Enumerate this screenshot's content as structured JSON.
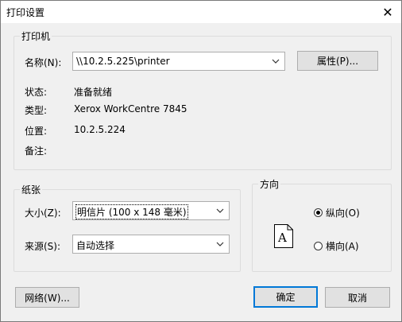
{
  "window": {
    "title": "打印设置",
    "close_glyph": "✕"
  },
  "printer": {
    "group_label": "打印机",
    "name_label": "名称(N):",
    "name_value": "\\\\10.2.5.225\\printer",
    "properties_button": "属性(P)...",
    "status_label": "状态:",
    "status_value": "准备就绪",
    "type_label": "类型:",
    "type_value": "Xerox WorkCentre 7845",
    "location_label": "位置:",
    "location_value": "10.2.5.224",
    "comment_label": "备注:",
    "comment_value": ""
  },
  "paper": {
    "group_label": "纸张",
    "size_label": "大小(Z):",
    "size_value": "明信片 (100 x 148 毫米)",
    "source_label": "来源(S):",
    "source_value": "自动选择"
  },
  "orientation": {
    "group_label": "方向",
    "portrait_label": "纵向(O)",
    "landscape_label": "横向(A)",
    "selected": "portrait",
    "icon_letter": "A"
  },
  "footer": {
    "network_button": "网络(W)...",
    "ok_button": "确定",
    "cancel_button": "取消"
  },
  "icons": {
    "close": "close-icon",
    "dropdown": "chevron-down-icon",
    "orientation": "portrait-page-icon"
  }
}
